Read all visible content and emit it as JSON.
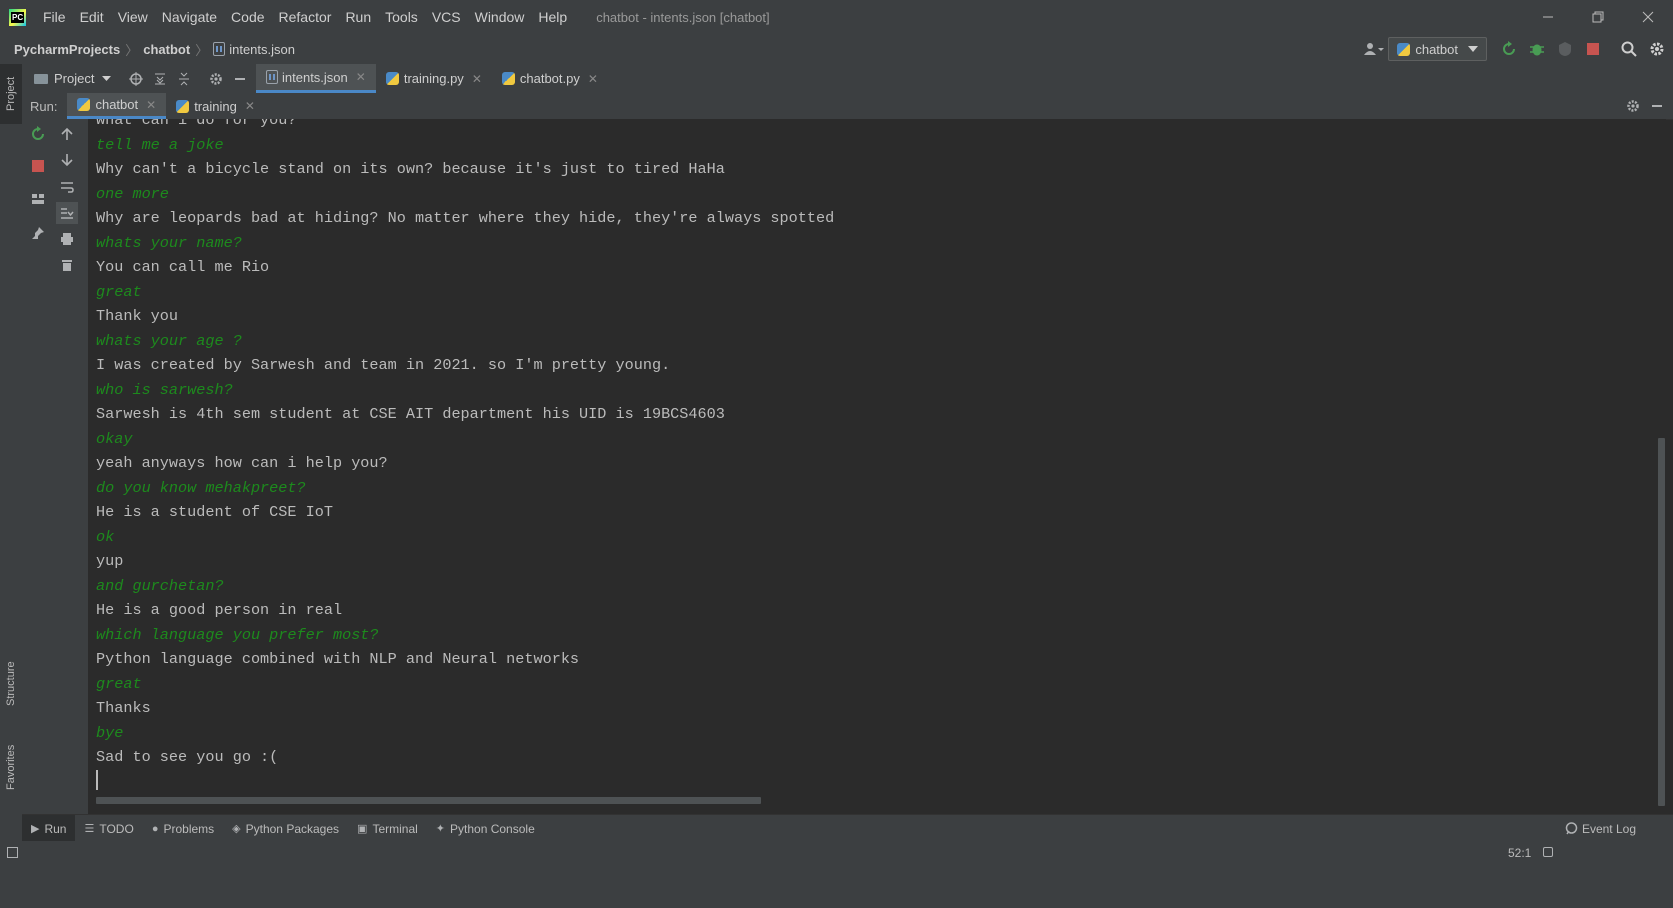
{
  "menu": [
    "File",
    "Edit",
    "View",
    "Navigate",
    "Code",
    "Refactor",
    "Run",
    "Tools",
    "VCS",
    "Window",
    "Help"
  ],
  "window_title": "chatbot - intents.json [chatbot]",
  "breadcrumb": {
    "root": "PycharmProjects",
    "project": "chatbot",
    "file": "intents.json"
  },
  "run_config": "chatbot",
  "project_dropdown": "Project",
  "editor_tabs": [
    "intents.json",
    "training.py",
    "chatbot.py"
  ],
  "run_panel": {
    "label": "Run:",
    "tabs": [
      "chatbot",
      "training"
    ]
  },
  "side_tabs": {
    "project": "Project",
    "structure": "Structure",
    "favorites": "Favorites"
  },
  "console_lines": [
    {
      "type": "bot",
      "text": "what can i do for you?"
    },
    {
      "type": "user",
      "text": "tell me a joke"
    },
    {
      "type": "bot",
      "text": "Why can't a bicycle stand on its own? because it's just to tired HaHa"
    },
    {
      "type": "user",
      "text": "one more"
    },
    {
      "type": "bot",
      "text": "Why are leopards bad at hiding? No matter where they hide, they're always spotted"
    },
    {
      "type": "user",
      "text": "whats your name?"
    },
    {
      "type": "bot",
      "text": "You can call me Rio"
    },
    {
      "type": "user",
      "text": "great"
    },
    {
      "type": "bot",
      "text": "Thank you"
    },
    {
      "type": "user",
      "text": "whats your age ?"
    },
    {
      "type": "bot",
      "text": "I was created by Sarwesh and team in 2021. so I'm pretty young."
    },
    {
      "type": "user",
      "text": "who is sarwesh?"
    },
    {
      "type": "bot",
      "text": "Sarwesh is 4th sem student at CSE AIT department his UID is 19BCS4603"
    },
    {
      "type": "user",
      "text": "okay"
    },
    {
      "type": "bot",
      "text": "yeah anyways how can i help you?"
    },
    {
      "type": "user",
      "text": "do you know mehakpreet?"
    },
    {
      "type": "bot",
      "text": "He is a student of CSE IoT"
    },
    {
      "type": "user",
      "text": "ok"
    },
    {
      "type": "bot",
      "text": "yup"
    },
    {
      "type": "user",
      "text": "and gurchetan?"
    },
    {
      "type": "bot",
      "text": "He is a good person in real"
    },
    {
      "type": "user",
      "text": "which language you prefer most?"
    },
    {
      "type": "bot",
      "text": "Python language combined with NLP and Neural networks"
    },
    {
      "type": "user",
      "text": "great"
    },
    {
      "type": "bot",
      "text": "Thanks"
    },
    {
      "type": "user",
      "text": "bye"
    },
    {
      "type": "bot",
      "text": "Sad to see you go :("
    }
  ],
  "bottom_tools": [
    "Run",
    "TODO",
    "Problems",
    "Python Packages",
    "Terminal",
    "Python Console"
  ],
  "event_log": "Event Log",
  "cursor_position": "52:1",
  "colors": {
    "user_text": "#1d8a1d",
    "bot_text": "#bbbbbb",
    "accent": "#4a88c7"
  }
}
